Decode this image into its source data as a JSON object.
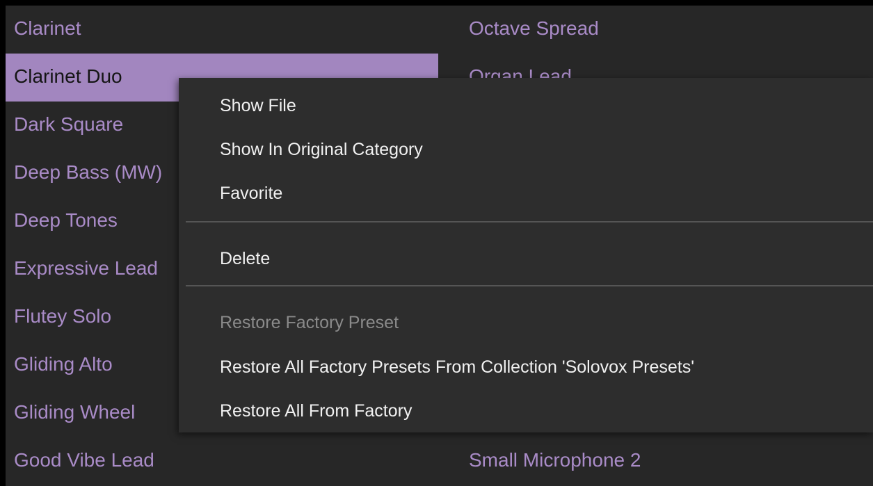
{
  "colors": {
    "preset_text": "#a98bc7",
    "selected_background": "#a286bf",
    "selected_text": "#151515",
    "panel_background": "#272727",
    "menu_background": "#2d2d2d",
    "menu_text": "#f1f1f1",
    "menu_disabled_text": "#8a8a8a"
  },
  "preset_list": {
    "left_column": [
      {
        "label": "Clarinet",
        "selected": false
      },
      {
        "label": "Clarinet Duo",
        "selected": true
      },
      {
        "label": "Dark Square",
        "selected": false
      },
      {
        "label": "Deep Bass (MW)",
        "selected": false
      },
      {
        "label": "Deep Tones",
        "selected": false
      },
      {
        "label": "Expressive Lead",
        "selected": false
      },
      {
        "label": "Flutey Solo",
        "selected": false
      },
      {
        "label": "Gliding Alto",
        "selected": false
      },
      {
        "label": "Gliding Wheel",
        "selected": false
      },
      {
        "label": "Good Vibe Lead",
        "selected": false
      }
    ],
    "right_column": [
      {
        "label": "Octave Spread"
      },
      {
        "label": "Organ Lead"
      },
      {
        "label": ""
      },
      {
        "label": ""
      },
      {
        "label": ""
      },
      {
        "label": ""
      },
      {
        "label": ""
      },
      {
        "label": ""
      },
      {
        "label": ""
      },
      {
        "label": "Small Microphone 2"
      }
    ]
  },
  "context_menu": {
    "items": [
      {
        "label": "Show File",
        "enabled": true
      },
      {
        "label": "Show In Original Category",
        "enabled": true
      },
      {
        "label": "Favorite",
        "enabled": true
      },
      {
        "label": "Delete",
        "enabled": true
      },
      {
        "label": "Restore Factory Preset",
        "enabled": false
      },
      {
        "label": "Restore All Factory Presets From Collection 'Solovox Presets'",
        "enabled": true
      },
      {
        "label": "Restore All From Factory",
        "enabled": true
      }
    ]
  }
}
